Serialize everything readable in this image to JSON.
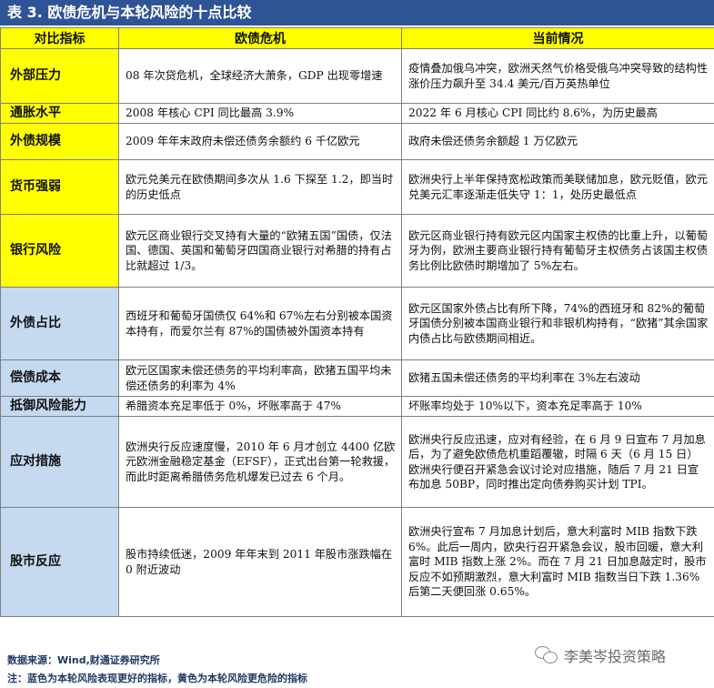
{
  "title": "表 3. 欧债危机与本轮风险的十点比较",
  "headers": [
    "对比指标",
    "欧债危机",
    "当前情况"
  ],
  "rows": [
    {
      "label": "外部压力",
      "label_color": "yellow",
      "past": "08 年次贷危机，全球经济大萧条，GDP 出现零增速",
      "now": "疫情叠加俄乌冲突，欧洲天然气价格受俄乌冲突导致的结构性涨价压力飙升至 34.4 美元/百万英热单位"
    },
    {
      "label": "通胀水平",
      "label_color": "yellow",
      "past": "2008 年核心 CPI 同比最高 3.9%",
      "now": "2022 年 6 月核心 CPI 同比约 8.6%，为历史最高"
    },
    {
      "label": "外债规模",
      "label_color": "yellow",
      "past": "2009 年年末政府未偿还债务余额约 6 千亿欧元",
      "now": "政府未偿还债务余额超 1 万亿欧元"
    },
    {
      "label": "货币强弱",
      "label_color": "yellow",
      "past": "欧元兑美元在欧债期间多次从 1.6 下探至 1.2，即当时的历史低点",
      "now": "欧洲央行上半年保持宽松政策而美联储加息，欧元贬值，欧元兑美元汇率逐渐走低失守 1：1，处历史最低点"
    },
    {
      "label": "银行风险",
      "label_color": "yellow",
      "past": "欧元区商业银行交叉持有大量的“欧猪五国”国债，仅法国、德国、英国和葡萄牙四国商业银行对希腊的持有占比就超过 1/3。",
      "now": "欧元区商业银行持有欧元区内国家主权债的比重上升，以葡萄牙为例，欧洲主要商业银行持有葡萄牙主权债务占该国主权债务比例比欧债时期增加了 5%左右。"
    },
    {
      "label": "外债占比",
      "label_color": "blue",
      "past": "西班牙和葡萄牙国债仅 64%和 67%左右分别被本国资本持有，而爱尔兰有 87%的国债被外国资本持有",
      "now": "欧元区国家外债占比有所下降，74%的西班牙和 82%的葡萄牙国债分别被本国商业银行和非银机构持有，“欧猪”其余国家内债占比与欧债期间相近。"
    },
    {
      "label": "偿债成本",
      "label_color": "blue",
      "past": "欧元区国家未偿还债务的平均利率高，欧猪五国平均未偿还债务的利率为 4%",
      "now": "欧猪五国未偿还债务的平均利率在 3%左右波动"
    },
    {
      "label": "抵御风险能力",
      "label_color": "blue",
      "past": "希腊资本充足率低于 0%，坏账率高于 47%",
      "now": "坏账率均处于 10%以下，资本充足率高于 10%"
    },
    {
      "label": "应对措施",
      "label_color": "blue",
      "past": "欧洲央行反应速度慢，2010 年 6 月才创立 4400 亿欧元欧洲金融稳定基金（EFSF），正式出台第一轮救援，而此时距离希腊债务危机爆发已过去 6 个月。",
      "now": "欧洲央行反应迅速，应对有经验，在 6 月 9 日宣布 7 月加息后，为了避免欧债危机重蹈覆辙，时隔 6 天（6 月 15 日）欧洲央行便召开紧急会议讨论对应措施，随后 7 月 21 日宣布加息 50BP，同时推出定向债券购买计划 TPI。"
    },
    {
      "label": "股市反应",
      "label_color": "blue",
      "past": "股市持续低迷，2009 年年末到 2011 年股市涨跌幅在 0 附近波动",
      "now": "欧洲央行宣布 7 月加息计划后，意大利富时 MIB 指数下跌 6%。此后一周内，欧央行召开紧急会议，股市回暖，意大利富时 MIB 指数上涨 2%。而在 7 月 21 日加息敲定时，股市反应不如预期激烈，意大利富时 MIB 指数当日下跌 1.36%后第二天便回涨 0.65%。"
    }
  ],
  "footer": {
    "source": "数据来源：Wind,财通证券研究所",
    "note": "注：蓝色为本轮风险表现更好的指标，黄色为本轮风险更危险的指标"
  },
  "watermark": "李美岑投资策略",
  "colors": {
    "header_bg": "#2f5496",
    "yellow": "#ffff00",
    "blue": "#c5d9f1"
  }
}
